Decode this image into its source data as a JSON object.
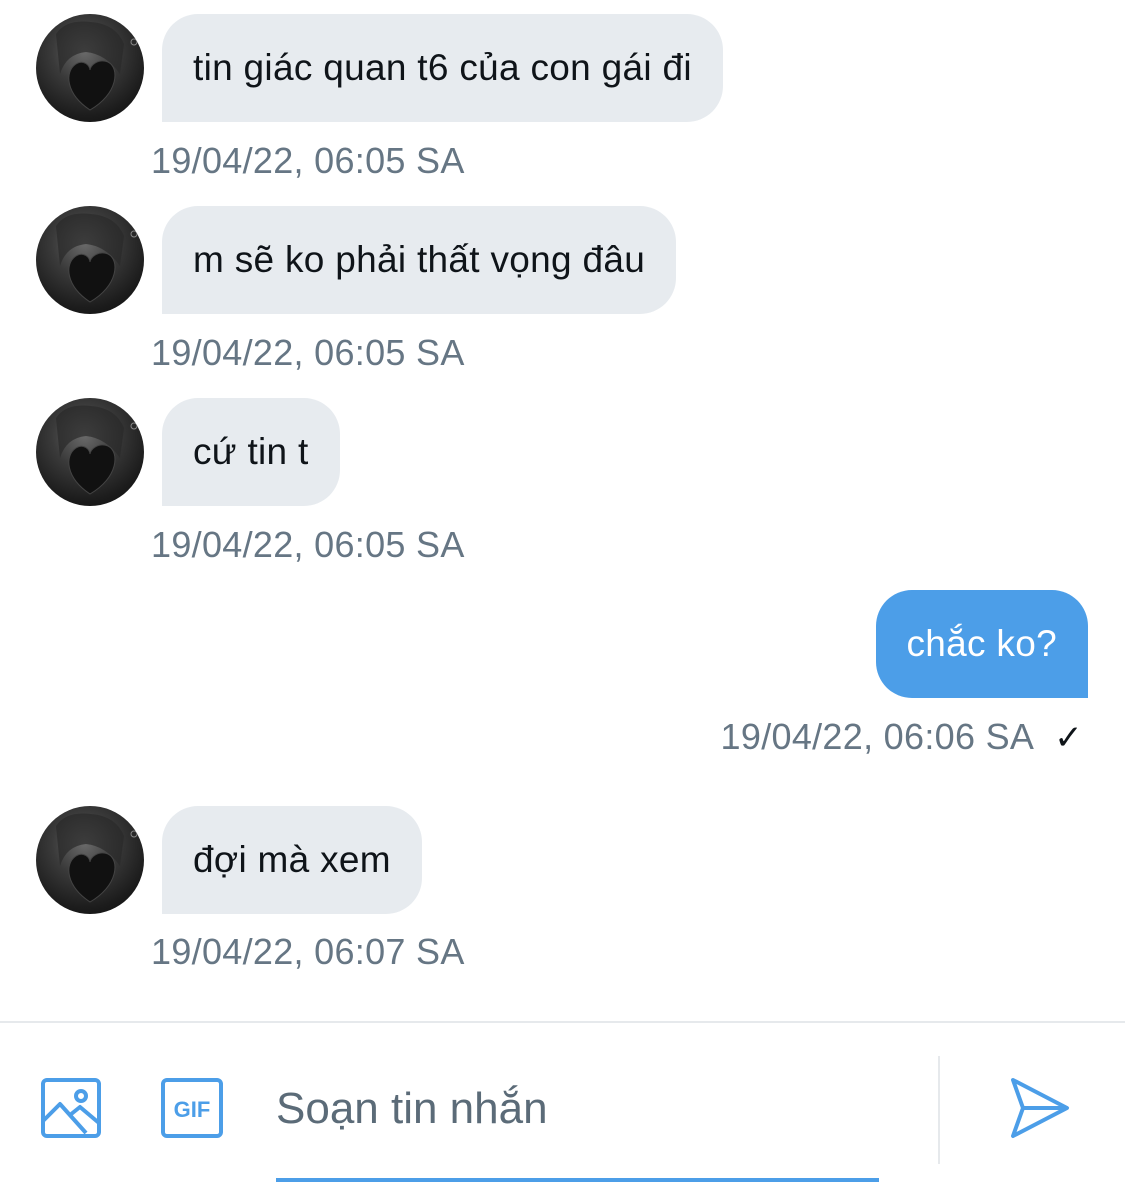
{
  "conversation": {
    "messages": [
      {
        "direction": "in",
        "text": "tin giác quan t6 của con gái đi",
        "timestamp": "19/04/22, 06:05 SA"
      },
      {
        "direction": "in",
        "text": "m sẽ ko phải thất vọng đâu",
        "timestamp": "19/04/22, 06:05 SA"
      },
      {
        "direction": "in",
        "text": "cứ tin t",
        "timestamp": "19/04/22, 06:05 SA"
      },
      {
        "direction": "out",
        "text": "chắc ko?",
        "timestamp": "19/04/22, 06:06 SA",
        "status_icon": "check-icon"
      },
      {
        "direction": "in",
        "text": "đợi mà xem",
        "timestamp": "19/04/22, 06:07 SA"
      }
    ]
  },
  "composer": {
    "placeholder": "Soạn tin nhắn",
    "value": "",
    "gif_label": "GIF",
    "icons": [
      "image-icon",
      "gif-icon",
      "send-icon"
    ]
  },
  "colors": {
    "accent": "#4c9ee8",
    "incoming_bubble": "#e7ebef",
    "timestamp": "#667684"
  }
}
